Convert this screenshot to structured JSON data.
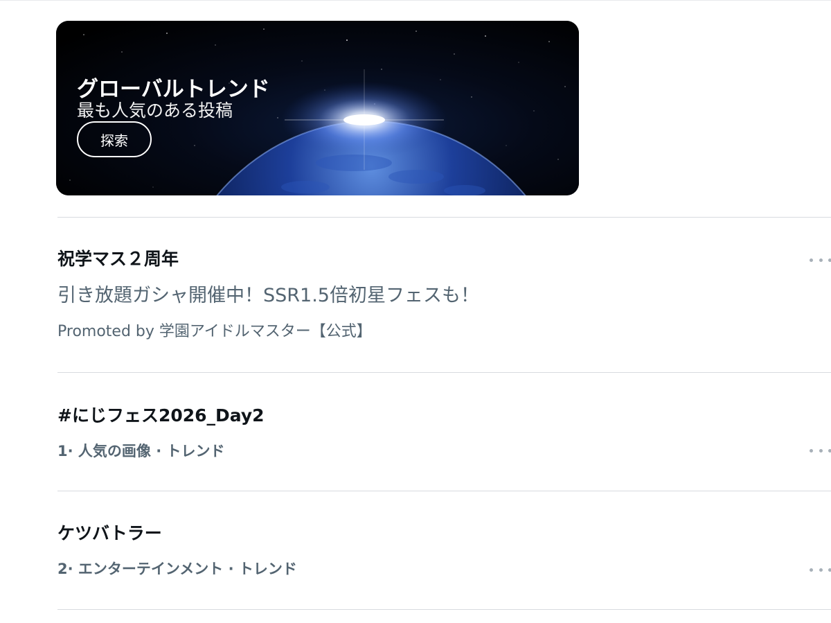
{
  "banner": {
    "title": "グローバルトレンド",
    "subtitle": "最も人気のある投稿",
    "explore_label": "探索"
  },
  "trends": [
    {
      "title": "祝学マス２周年",
      "description": "引き放題ガシャ開催中！SSR1.5倍初星フェスも！",
      "promoted": "Promoted by 学園アイドルマスター【公式】"
    },
    {
      "title": "#にじフェス2026_Day2",
      "meta": "1· 人気の画像 · トレンド"
    },
    {
      "title": "ケツバトラー",
      "meta": "2· エンターテインメント · トレンド"
    }
  ],
  "icons": {
    "more": "more-horizontal-icon",
    "banner_image": "earth-from-space-image"
  },
  "colors": {
    "primary_text": "#0f1419",
    "secondary_text": "#536471",
    "divider": "#d8dbdf",
    "banner_bg": "#000000",
    "more_dots": "#a7b0b8"
  }
}
